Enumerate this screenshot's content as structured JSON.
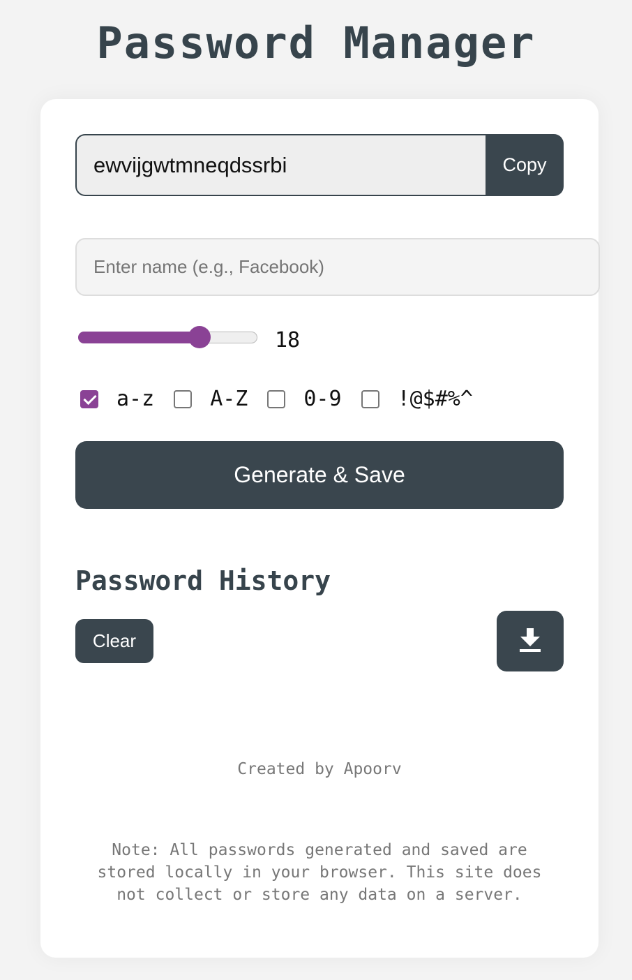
{
  "header": {
    "title": "Password Manager"
  },
  "generator": {
    "password_value": "ewvijgwtmneqdssrbi",
    "copy_label": "Copy",
    "name_placeholder": "Enter name (e.g., Facebook)",
    "length": {
      "value": "18",
      "min": 4,
      "max": 24
    },
    "options": [
      {
        "label": "a-z",
        "checked": true
      },
      {
        "label": "A-Z",
        "checked": false
      },
      {
        "label": "0-9",
        "checked": false
      },
      {
        "label": "!@$#%^",
        "checked": false
      }
    ],
    "generate_label": "Generate & Save"
  },
  "history": {
    "title": "Password History",
    "clear_label": "Clear",
    "download_icon": "download-icon"
  },
  "footer": {
    "credit": "Created by Apoorv",
    "note": "Note: All passwords generated and saved are stored locally in your browser. This site does not collect or store any data on a server."
  },
  "colors": {
    "background": "#f3f3f3",
    "primary_dark": "#3a464e",
    "accent": "#8a4295",
    "muted_text": "#777777"
  }
}
